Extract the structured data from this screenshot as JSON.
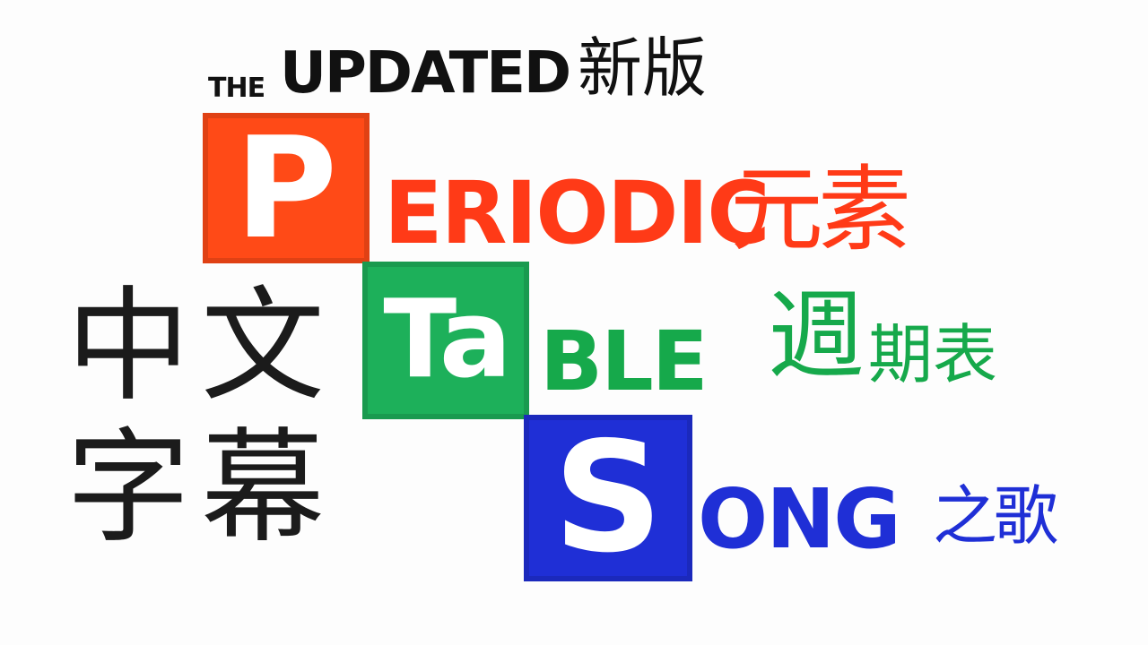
{
  "title": {
    "the": "THE",
    "updated": "UPDATED",
    "updated_cn": "新版"
  },
  "rows": [
    {
      "tile": "P",
      "rest": "ERIODIC",
      "cn": "元素",
      "color": "#ff4a17"
    },
    {
      "tile": "Ta",
      "rest": "BLE",
      "cn_big": "週",
      "cn_small": "期表",
      "color": "#1db05a"
    },
    {
      "tile": "S",
      "rest": "ONG",
      "cn": "之歌",
      "color": "#1f2fd6"
    }
  ],
  "subtitle_label": {
    "chars": [
      "中",
      "文",
      "字",
      "幕"
    ]
  },
  "colors": {
    "text_black": "#111111",
    "background": "#fdfdfd"
  }
}
